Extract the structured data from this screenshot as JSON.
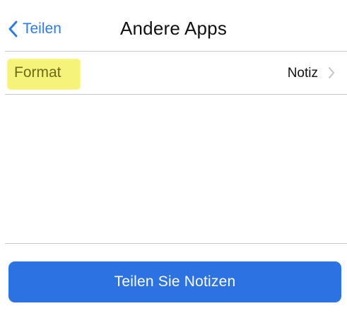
{
  "nav": {
    "back_label": "Teilen",
    "title": "Andere Apps"
  },
  "settings": {
    "format_row": {
      "label": "Format",
      "value": "Notiz"
    }
  },
  "actions": {
    "share_label": "Teilen Sie Notizen"
  },
  "colors": {
    "accent": "#2f7be0",
    "button": "#2d72e1",
    "highlight": "#f6f37b",
    "divider": "#c8c7cc"
  },
  "icons": {
    "back": "chevron-left-icon",
    "disclosure": "chevron-right-icon"
  }
}
